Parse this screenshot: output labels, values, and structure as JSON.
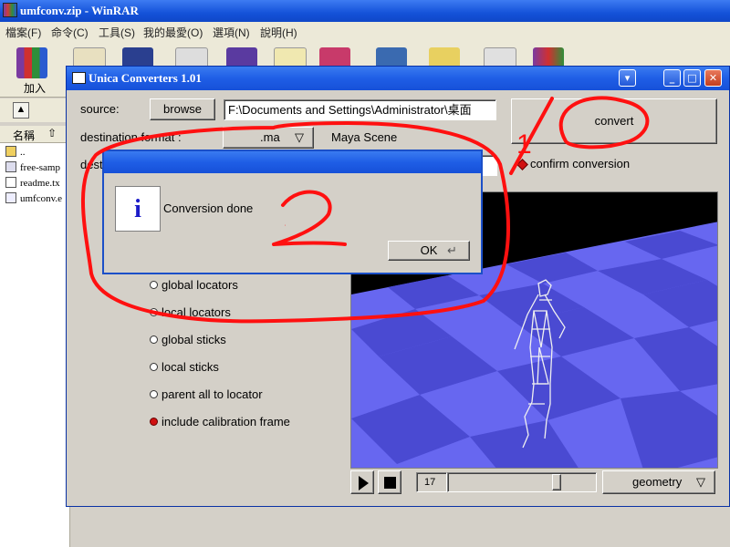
{
  "winrar": {
    "title": "umfconv.zip - WinRAR",
    "menu": [
      "檔案(F)",
      "命令(C)",
      "工具(S)",
      "我的最愛(O)",
      "選項(N)",
      "說明(H)"
    ],
    "toolbar_add_label": "加入",
    "column_name": "名稱",
    "sort_arrow": "⇧",
    "files": [
      "..",
      "free-samp",
      "readme.tx",
      "umfconv.e"
    ]
  },
  "unica": {
    "title": "Unica Converters 1.01",
    "source_label": "source:",
    "browse_label": "browse",
    "source_path": "F:\\Documents and Settings\\Administrator\\桌面",
    "convert_label": "convert",
    "dest_format_label": "destination format :",
    "dest_format_value": ".ma",
    "dest_format_desc": "Maya Scene",
    "dest_label": "dest",
    "confirm_label": "confirm conversion",
    "options": [
      {
        "label": "global locators",
        "selected": false
      },
      {
        "label": "local locators",
        "selected": false
      },
      {
        "label": "global sticks",
        "selected": false
      },
      {
        "label": "local sticks",
        "selected": false
      },
      {
        "label": "parent all to locator",
        "selected": false
      },
      {
        "label": "include calibration frame",
        "selected": true
      }
    ],
    "frame_number": "17",
    "view_mode": "geometry"
  },
  "dialog": {
    "message": "Conversion done",
    "ok_label": "OK",
    "icon": "info-icon"
  },
  "annotations": [
    "1",
    "2"
  ]
}
